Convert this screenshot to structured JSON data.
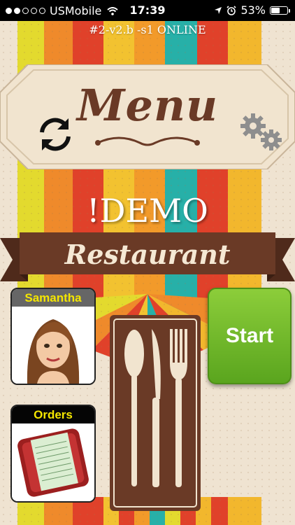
{
  "status_bar": {
    "carrier": "USMobile",
    "time": "17:39",
    "battery": "53%",
    "battery_level": 0.53
  },
  "header": {
    "version_text": "#2-v2.b -s1 ONLINE",
    "menu_title": "Menu"
  },
  "restaurant": {
    "name": "!DEMO",
    "subtitle": "Restaurant"
  },
  "cards": {
    "waiter_name": "Samantha",
    "orders_label": "Orders"
  },
  "actions": {
    "start_label": "Start"
  },
  "icons": {
    "refresh": "refresh-icon",
    "settings": "gear-icon",
    "cutlery": "cutlery-icon"
  },
  "colors": {
    "brown": "#6a3a26",
    "start_green": "#6dbb2a",
    "header_yellow": "#f4e600"
  }
}
